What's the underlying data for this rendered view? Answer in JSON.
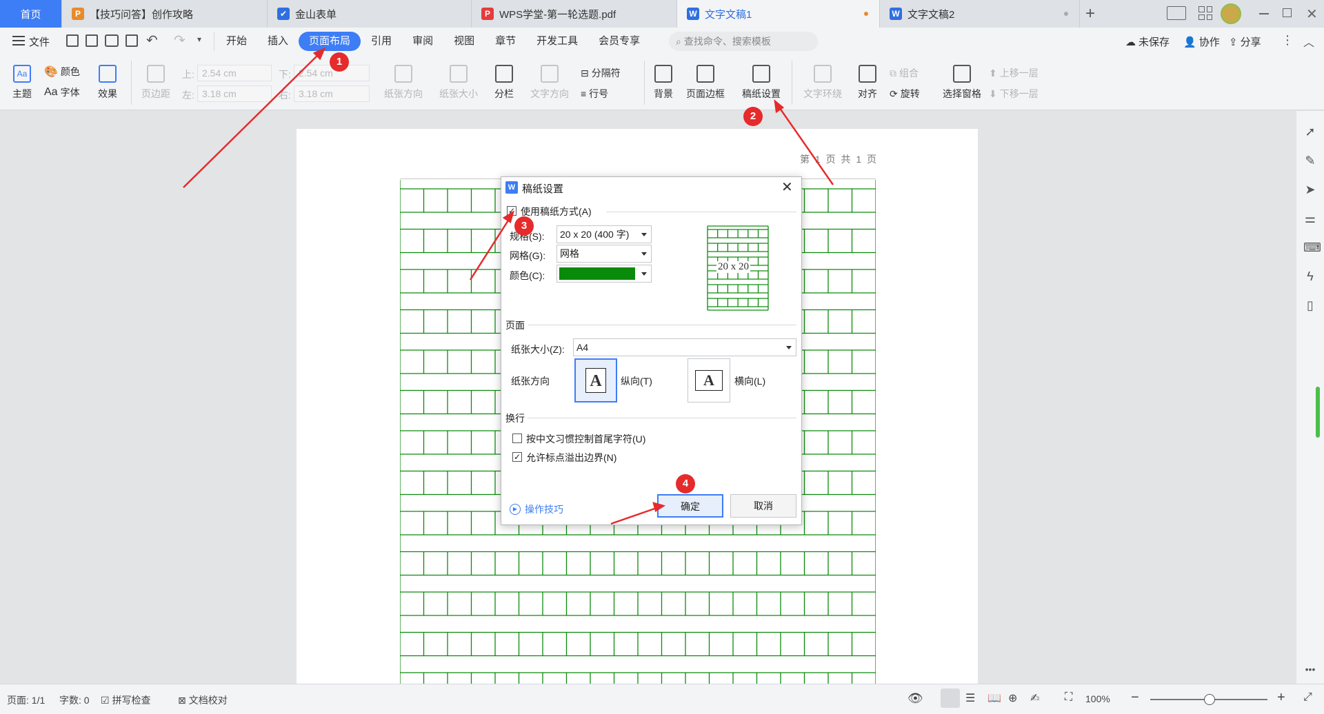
{
  "tabs": [
    {
      "label": "首页"
    },
    {
      "label": "【技巧问答】创作攻略",
      "icon": "P"
    },
    {
      "label": "金山表单",
      "icon": "✔"
    },
    {
      "label": "WPS学堂-第一轮选题.pdf",
      "icon": "P"
    },
    {
      "label": "文字文稿1",
      "icon": "W"
    },
    {
      "label": "文字文稿2",
      "icon": "W"
    }
  ],
  "menu": {
    "file": "文件",
    "items": [
      "开始",
      "插入",
      "页面布局",
      "引用",
      "审阅",
      "视图",
      "章节",
      "开发工具",
      "会员专享"
    ],
    "search_placeholder": "查找命令、搜索模板",
    "unsaved": "未保存",
    "collab": "协作",
    "share": "分享"
  },
  "ribbon": {
    "theme": "主题",
    "color": "颜色",
    "font": "字体",
    "effect": "效果",
    "margin": "页边距",
    "top_label": "上:",
    "top_val": "2.54 cm",
    "bottom_label": "下:",
    "bottom_val": "2.54 cm",
    "left_label": "左:",
    "left_val": "3.18 cm",
    "right_label": "右:",
    "right_val": "3.18 cm",
    "orientation": "纸张方向",
    "size": "纸张大小",
    "columns": "分栏",
    "textdir": "文字方向",
    "separator": "分隔符",
    "linenum": "行号",
    "background": "背景",
    "border": "页面边框",
    "grid_setting": "稿纸设置",
    "wrap": "文字环绕",
    "align": "对齐",
    "rotate": "旋转",
    "group": "组合",
    "select_pane": "选择窗格",
    "bring_up": "上移一层",
    "send_down": "下移一层"
  },
  "page": {
    "header": "第 1 页 共 1 页"
  },
  "dialog": {
    "title": "稿纸设置",
    "use_grid": "使用稿纸方式(A)",
    "spec_label": "规格(S):",
    "spec_val": "20 x 20 (400 字)",
    "grid_label": "网格(G):",
    "grid_val": "网格",
    "color_label": "颜色(C):",
    "color_hex": "#0a8a0a",
    "preview_label": "20 x 20",
    "page_section": "页面",
    "paper_size_label": "纸张大小(Z):",
    "paper_size_val": "A4",
    "orient_label": "纸张方向",
    "portrait": "纵向(T)",
    "landscape": "横向(L)",
    "wrap_section": "换行",
    "cb1": "按中文习惯控制首尾字符(U)",
    "cb2": "允许标点溢出边界(N)",
    "tips": "操作技巧",
    "ok": "确定",
    "cancel": "取消"
  },
  "status": {
    "page": "页面: 1/1",
    "words": "字数: 0",
    "spell": "拼写检查",
    "proof": "文档校对",
    "zoom": "100%"
  },
  "badges": [
    "1",
    "2",
    "3",
    "4"
  ],
  "colors": {
    "accent": "#3d7df5",
    "grid": "#0a8a0a",
    "annotation": "#e52b2b"
  }
}
